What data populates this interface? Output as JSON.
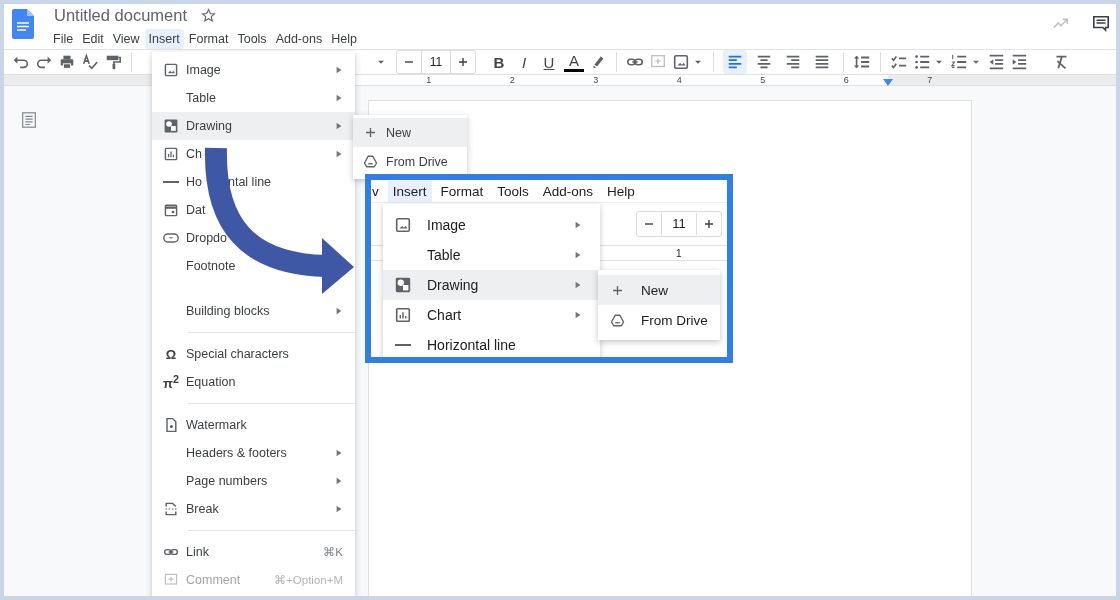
{
  "document": {
    "title": "Untitled document"
  },
  "menu_bar": [
    {
      "label": "File",
      "selected": false
    },
    {
      "label": "Edit",
      "selected": false
    },
    {
      "label": "View",
      "selected": false
    },
    {
      "label": "Insert",
      "selected": true
    },
    {
      "label": "Format",
      "selected": false
    },
    {
      "label": "Tools",
      "selected": false
    },
    {
      "label": "Add-ons",
      "selected": false
    },
    {
      "label": "Help",
      "selected": false
    }
  ],
  "toolbar": {
    "font_size": "11",
    "format_buttons": [
      "B",
      "I",
      "U"
    ],
    "text_color_button": "A",
    "alignment": [
      {
        "selected": true
      },
      {
        "selected": false
      },
      {
        "selected": false
      },
      {
        "selected": false
      }
    ]
  },
  "ruler": {
    "numbers": [
      "1",
      "2",
      "3",
      "4",
      "5",
      "6",
      "7"
    ]
  },
  "insert_menu": {
    "items": [
      {
        "kind": "item",
        "label": "Image",
        "has_submenu": true,
        "selected": false,
        "disabled": false
      },
      {
        "kind": "item",
        "label": "Table",
        "has_submenu": true,
        "selected": false,
        "disabled": false
      },
      {
        "kind": "item",
        "label": "Drawing",
        "has_submenu": true,
        "selected": true,
        "disabled": false
      },
      {
        "kind": "item",
        "label": "Ch",
        "has_submenu": true,
        "selected": false,
        "disabled": false
      },
      {
        "kind": "item",
        "label": "Ho",
        "label_tail": "ntal line",
        "has_submenu": false,
        "selected": false,
        "disabled": false
      },
      {
        "kind": "item",
        "label": "Dat",
        "has_submenu": false,
        "selected": false,
        "disabled": false
      },
      {
        "kind": "item",
        "label": "Dropdo",
        "has_submenu": false,
        "selected": false,
        "disabled": false
      },
      {
        "kind": "item",
        "label": "Footnote",
        "has_submenu": false,
        "selected": false,
        "disabled": false
      },
      {
        "kind": "gap"
      },
      {
        "kind": "item",
        "label": "Building blocks",
        "has_submenu": true,
        "selected": false,
        "disabled": false
      },
      {
        "kind": "divider"
      },
      {
        "kind": "item",
        "label": "Special characters",
        "glyph": "Ω",
        "has_submenu": false,
        "selected": false,
        "disabled": false
      },
      {
        "kind": "item",
        "label": "Equation",
        "glyph": "π$^{2}$",
        "has_submenu": false,
        "selected": false,
        "disabled": false
      },
      {
        "kind": "divider"
      },
      {
        "kind": "item",
        "label": "Watermark",
        "has_submenu": false,
        "selected": false,
        "disabled": false
      },
      {
        "kind": "item",
        "label": "Headers & footers",
        "has_submenu": true,
        "selected": false,
        "disabled": false
      },
      {
        "kind": "item",
        "label": "Page numbers",
        "has_submenu": true,
        "selected": false,
        "disabled": false
      },
      {
        "kind": "item",
        "label": "Break",
        "has_submenu": true,
        "selected": false,
        "disabled": false
      },
      {
        "kind": "divider"
      },
      {
        "kind": "item",
        "label": "Link",
        "shortcut": "⌘K",
        "has_submenu": false,
        "selected": false,
        "disabled": false
      },
      {
        "kind": "item",
        "label": "Comment",
        "shortcut": "⌘+Option+M",
        "has_submenu": false,
        "selected": false,
        "disabled": true
      }
    ]
  },
  "drawing_submenu": {
    "items": [
      {
        "label": "New",
        "selected": true
      },
      {
        "label": "From Drive",
        "selected": false
      }
    ]
  },
  "zoom_inset": {
    "menu_bar": [
      {
        "label": "v",
        "selected": false
      },
      {
        "label": "Insert",
        "selected": true
      },
      {
        "label": "Format",
        "selected": false
      },
      {
        "label": "Tools",
        "selected": false
      },
      {
        "label": "Add-ons",
        "selected": false
      },
      {
        "label": "Help",
        "selected": false
      }
    ],
    "font_size": "11",
    "ruler_number": "1",
    "insert_menu": [
      {
        "label": "Image",
        "has_submenu": true,
        "selected": false
      },
      {
        "label": "Table",
        "has_submenu": true,
        "selected": false
      },
      {
        "label": "Drawing",
        "has_submenu": true,
        "selected": true
      },
      {
        "label": "Chart",
        "has_submenu": true,
        "selected": false
      },
      {
        "label": "Horizontal line",
        "has_submenu": false,
        "selected": false
      }
    ],
    "drawing_submenu": [
      {
        "label": "New",
        "selected": true
      },
      {
        "label": "From Drive",
        "selected": false
      }
    ]
  }
}
